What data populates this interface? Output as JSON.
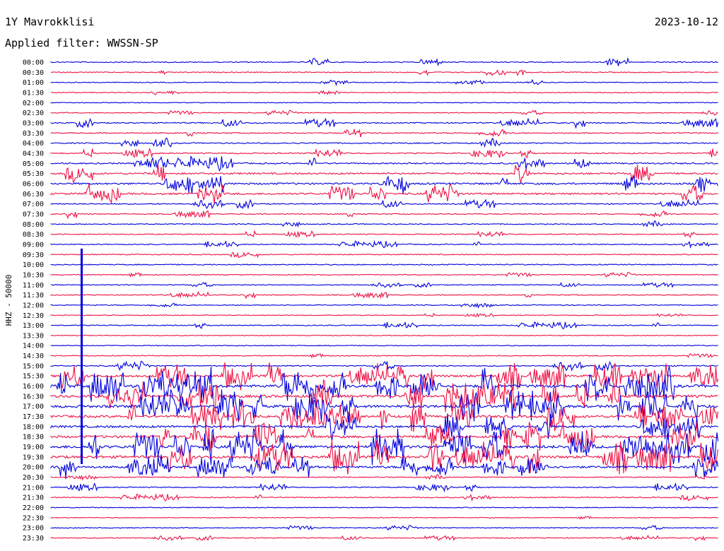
{
  "header": {
    "station": "1Y Mavrokklisi",
    "date": "2023-10-12",
    "filter": "Applied filter: WWSSN-SP"
  },
  "colors": {
    "even_trace": "#0000dd",
    "odd_trace": "#ee1144"
  },
  "chart_data": {
    "type": "line",
    "title": "1Y Mavrokklisi",
    "subtitle": "Applied filter: WWSSN-SP",
    "xlabel": "",
    "ylabel": "HHZ - 50000",
    "legend": "none",
    "grid": false,
    "row_labels": [
      "00:00",
      "00:30",
      "01:00",
      "01:30",
      "02:00",
      "02:30",
      "03:00",
      "03:30",
      "04:00",
      "04:30",
      "05:00",
      "05:30",
      "06:00",
      "06:30",
      "07:00",
      "07:30",
      "08:00",
      "08:30",
      "09:00",
      "09:30",
      "10:00",
      "10:30",
      "11:00",
      "11:30",
      "12:00",
      "12:30",
      "13:00",
      "13:30",
      "14:00",
      "14:30",
      "15:00",
      "15:30",
      "16:00",
      "16:30",
      "17:00",
      "17:30",
      "18:00",
      "18:30",
      "19:00",
      "19:30",
      "20:00",
      "20:30",
      "21:00",
      "21:30",
      "22:00",
      "22:30",
      "23:00",
      "23:30"
    ],
    "row_activity": [
      0.5,
      0.4,
      0.3,
      0.3,
      0.2,
      0.3,
      0.6,
      0.6,
      0.6,
      0.6,
      0.9,
      1.2,
      1.3,
      1.3,
      0.6,
      0.5,
      0.4,
      0.4,
      0.4,
      0.4,
      0.5,
      0.3,
      0.3,
      0.4,
      0.3,
      0.2,
      0.4,
      0.2,
      0.3,
      0.3,
      0.6,
      1.8,
      2.4,
      2.2,
      2.2,
      2.0,
      1.8,
      2.0,
      2.4,
      2.2,
      1.6,
      0.3,
      0.5,
      0.4,
      0.3,
      0.2,
      0.3,
      0.3
    ],
    "spike_rows": [
      24,
      25,
      26,
      27,
      28,
      29,
      30,
      31,
      32,
      33,
      34,
      35,
      36,
      37,
      38,
      39
    ]
  }
}
